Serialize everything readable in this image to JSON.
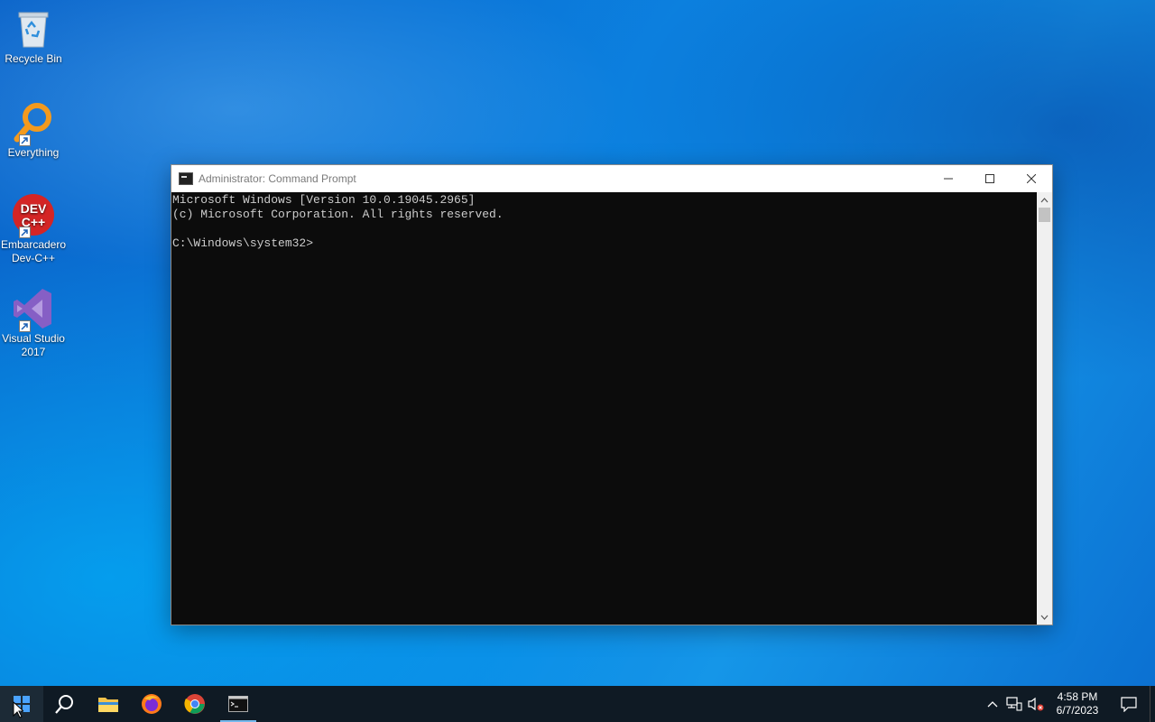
{
  "desktop": {
    "icons": [
      {
        "label": "Recycle Bin"
      },
      {
        "label": "Everything"
      },
      {
        "label": "Embarcadero Dev-C++",
        "badge_text": "DEV C++"
      },
      {
        "label": "Visual Studio 2017"
      }
    ]
  },
  "window": {
    "title": "Administrator: Command Prompt",
    "console_lines": [
      "Microsoft Windows [Version 10.0.19045.2965]",
      "(c) Microsoft Corporation. All rights reserved.",
      "",
      "C:\\Windows\\system32>"
    ]
  },
  "taskbar": {
    "items": [
      "start-icon",
      "search-icon",
      "file-explorer-icon",
      "firefox-icon",
      "chrome-icon",
      "command-prompt-icon"
    ],
    "clock": {
      "time": "4:58 PM",
      "date": "6/7/2023"
    }
  },
  "colors": {
    "console_bg": "#0c0c0c",
    "console_text": "#cccccc",
    "taskbar_bg": "#0f1a24",
    "accent": "#0b76d8"
  }
}
